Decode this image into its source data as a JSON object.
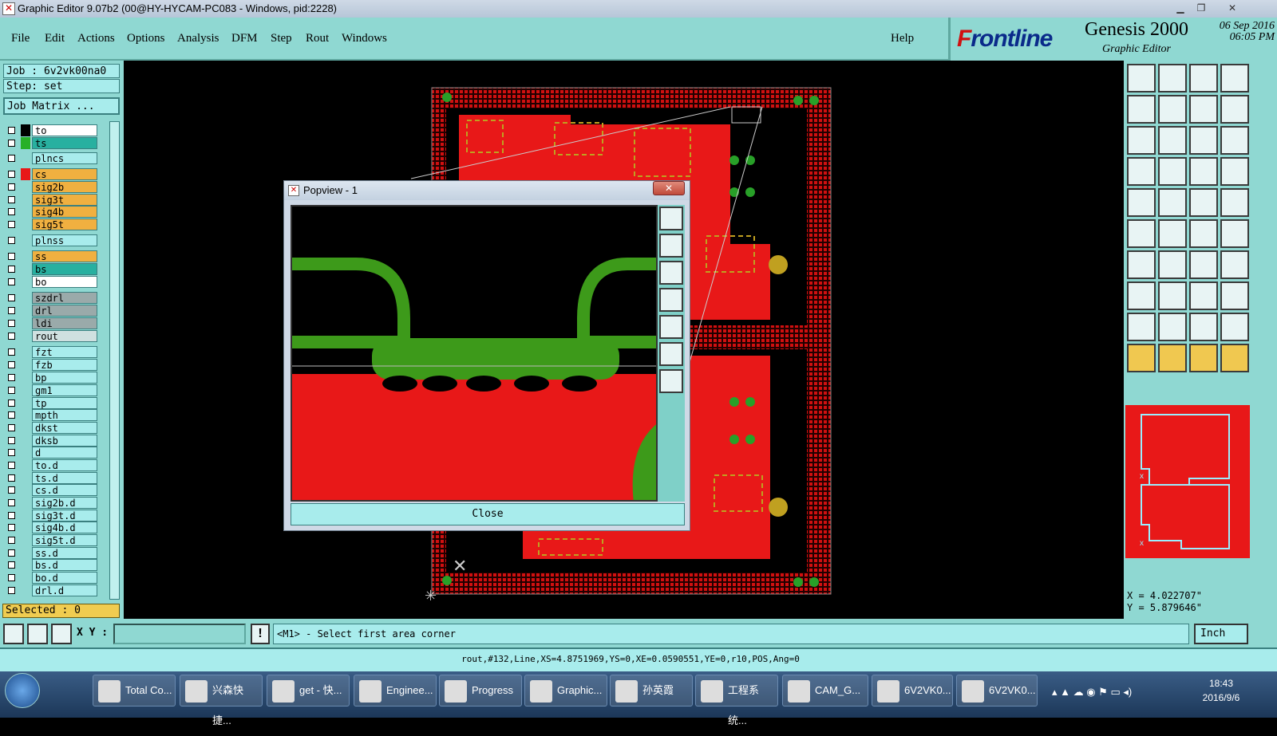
{
  "window": {
    "title": "Graphic Editor 9.07b2 (00@HY-HYCAM-PC083 - Windows, pid:2228)"
  },
  "menu": [
    "File",
    "Edit",
    "Actions",
    "Options",
    "Analysis",
    "DFM",
    "Step",
    "Rout",
    "Windows"
  ],
  "help": "Help",
  "brand": {
    "logo_a": "F",
    "logo_b": "rontline",
    "product": "Genesis 2000",
    "subtitle": "Graphic Editor",
    "date": "06 Sep 2016",
    "time": "06:05 PM"
  },
  "job": {
    "job": "Job : 6v2vk00na0",
    "step": "Step: set",
    "matrix": "Job Matrix ..."
  },
  "layers": [
    {
      "name": "to",
      "color": "#ffffff",
      "swatch": "#000000"
    },
    {
      "name": "ts",
      "color": "#28b0a0",
      "swatch": "#28b028"
    },
    {
      "name": "plncs",
      "color": "#a8ecec",
      "swatch": ""
    },
    {
      "name": "cs",
      "color": "#f0b040",
      "swatch": "#e81818"
    },
    {
      "name": "sig2b",
      "color": "#f0b040",
      "swatch": ""
    },
    {
      "name": "sig3t",
      "color": "#f0b040",
      "swatch": ""
    },
    {
      "name": "sig4b",
      "color": "#f0b040",
      "swatch": ""
    },
    {
      "name": "sig5t",
      "color": "#f0b040",
      "swatch": ""
    },
    {
      "name": "plnss",
      "color": "#a8ecec",
      "swatch": ""
    },
    {
      "name": "ss",
      "color": "#f0b040",
      "swatch": ""
    },
    {
      "name": "bs",
      "color": "#28b0a0",
      "swatch": ""
    },
    {
      "name": "bo",
      "color": "#ffffff",
      "swatch": ""
    },
    {
      "name": "szdrl",
      "color": "#9aaaaa",
      "swatch": ""
    },
    {
      "name": "drl",
      "color": "#9aaaaa",
      "swatch": ""
    },
    {
      "name": "ldi",
      "color": "#9aaaaa",
      "swatch": ""
    },
    {
      "name": "rout",
      "color": "#cfe0e0",
      "swatch": ""
    },
    {
      "name": "fzt",
      "color": "#a8ecec",
      "swatch": ""
    },
    {
      "name": "fzb",
      "color": "#a8ecec",
      "swatch": ""
    },
    {
      "name": "bp",
      "color": "#a8ecec",
      "swatch": ""
    },
    {
      "name": "gm1",
      "color": "#a8ecec",
      "swatch": ""
    },
    {
      "name": "tp",
      "color": "#a8ecec",
      "swatch": ""
    },
    {
      "name": "mpth",
      "color": "#a8ecec",
      "swatch": ""
    },
    {
      "name": "dkst",
      "color": "#a8ecec",
      "swatch": ""
    },
    {
      "name": "dksb",
      "color": "#a8ecec",
      "swatch": ""
    },
    {
      "name": "d",
      "color": "#a8ecec",
      "swatch": ""
    },
    {
      "name": "to.d",
      "color": "#a8ecec",
      "swatch": ""
    },
    {
      "name": "ts.d",
      "color": "#a8ecec",
      "swatch": ""
    },
    {
      "name": "cs.d",
      "color": "#a8ecec",
      "swatch": ""
    },
    {
      "name": "sig2b.d",
      "color": "#a8ecec",
      "swatch": ""
    },
    {
      "name": "sig3t.d",
      "color": "#a8ecec",
      "swatch": ""
    },
    {
      "name": "sig4b.d",
      "color": "#a8ecec",
      "swatch": ""
    },
    {
      "name": "sig5t.d",
      "color": "#a8ecec",
      "swatch": ""
    },
    {
      "name": "ss.d",
      "color": "#a8ecec",
      "swatch": ""
    },
    {
      "name": "bs.d",
      "color": "#a8ecec",
      "swatch": ""
    },
    {
      "name": "bo.d",
      "color": "#a8ecec",
      "swatch": ""
    },
    {
      "name": "drl.d",
      "color": "#a8ecec",
      "swatch": ""
    }
  ],
  "selected": "Selected : 0",
  "popup": {
    "title": "Popview - 1",
    "close": "Close",
    "x": "✕"
  },
  "coords": {
    "x": "X = 4.022707\"",
    "y": "Y = 5.879646\""
  },
  "cmd": {
    "xy_label": "X Y :",
    "xy_value": "",
    "prompt": "<M1> - Select first area corner",
    "unit": "Inch"
  },
  "status": "rout,#132,Line,XS=4.8751969,YS=0,XE=0.0590551,YE=0,r10,POS,Ang=0",
  "taskbar": {
    "items": [
      "Total Co...",
      "兴森快捷...",
      "get - 快...",
      "Enginee...",
      "Progress",
      "Graphic...",
      "孙英霞",
      "工程系统...",
      "CAM_G...",
      "6V2VK0...",
      "6V2VK0..."
    ],
    "time": "18:43",
    "date": "2016/9/6"
  }
}
